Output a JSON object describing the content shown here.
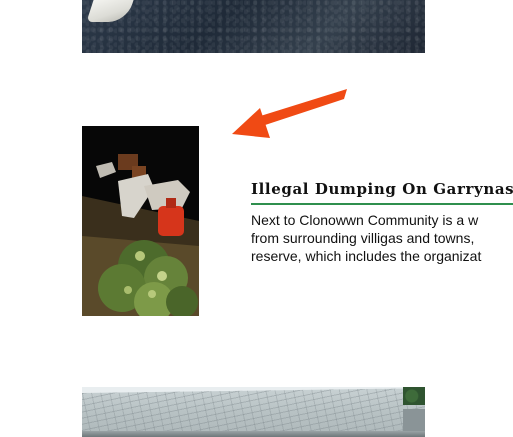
{
  "article": {
    "headline": "Illegal Dumping On Garrynashee",
    "paragraph_lines": [
      "Next to Clonowwn Community is a w",
      "from surrounding villigas and towns,",
      "reserve, which includes the organizat"
    ]
  },
  "colors": {
    "arrow": "#f04a14",
    "rule": "#2f8f4e"
  },
  "icons": {
    "arrow": "arrow-icon"
  }
}
